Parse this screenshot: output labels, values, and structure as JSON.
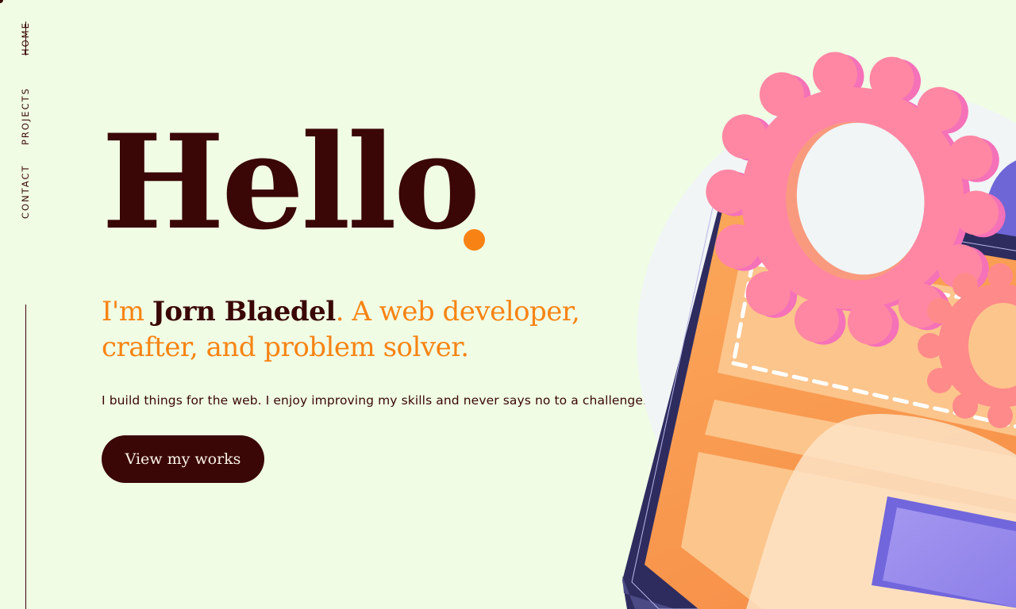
{
  "nav": {
    "items": [
      {
        "label": "HOME",
        "active": true
      },
      {
        "label": "PROJECTS",
        "active": false
      },
      {
        "label": "CONTACT",
        "active": false
      }
    ]
  },
  "hero": {
    "title": "Hello",
    "intro_prefix": "I'm ",
    "intro_name": "Jorn Blaedel",
    "intro_suffix": ". A web developer, crafter, and problem solver.",
    "blurb": "I build things for the web. I enjoy improving my skills and never says no to a challenge.",
    "cta_label": "View my works"
  },
  "colors": {
    "background": "#f0fde4",
    "text_dark": "#3a0606",
    "accent_orange": "#f88314",
    "gear_pink": "#ff85a5",
    "laptop_navy": "#2e2c5f",
    "screen_orange": "#f9a050",
    "purple": "#8b7ee8"
  },
  "illustration": {
    "icons": [
      "laptop-illustration",
      "gear-icon",
      "small-gear-icon"
    ]
  }
}
